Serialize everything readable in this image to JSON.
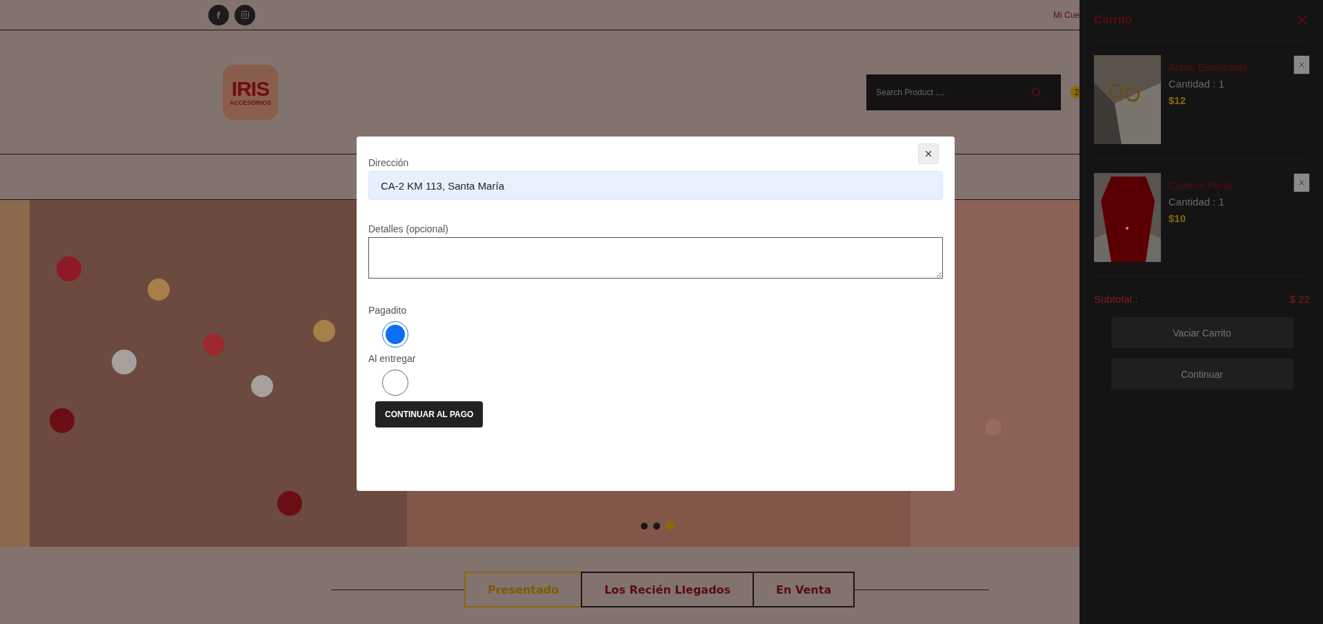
{
  "topbar": {
    "account_link": "Mi Cue"
  },
  "header": {
    "logo": {
      "title": "IRIS",
      "subtitle": "ACCESORIOS"
    },
    "search": {
      "placeholder": "Search Product ...."
    },
    "cart_count": "2"
  },
  "carousel": {
    "dots": [
      {
        "selected": false
      },
      {
        "selected": false
      },
      {
        "selected": true
      }
    ]
  },
  "tabs": [
    {
      "label": "Presentado",
      "selected": true
    },
    {
      "label": "Los Recién Llegados",
      "selected": false
    },
    {
      "label": "En Venta",
      "selected": false
    }
  ],
  "modal": {
    "address": {
      "label": "Dirección",
      "value": "CA-2 KM 113, Santa María"
    },
    "details": {
      "label": "Detalles (opcional)"
    },
    "payment_options": [
      {
        "label": "Pagadito",
        "selected": true
      },
      {
        "label": "Al entregar",
        "selected": false
      }
    ],
    "submit": "CONTINUAR AL PAGO"
  },
  "cart": {
    "title": "Carrito",
    "items": [
      {
        "name": "Aritos Esmeralda.",
        "quantity": "Cantidad : 1",
        "price": "$12",
        "kind": "earrings"
      },
      {
        "name": "Cadena Perla.",
        "quantity": "Cantidad : 1",
        "price": "$10",
        "kind": "necklace"
      }
    ],
    "subtotal_label": "Subtotal :",
    "subtotal": "$ 22",
    "buttons": [
      "Vaciar Carrito",
      "Continuar"
    ]
  }
}
